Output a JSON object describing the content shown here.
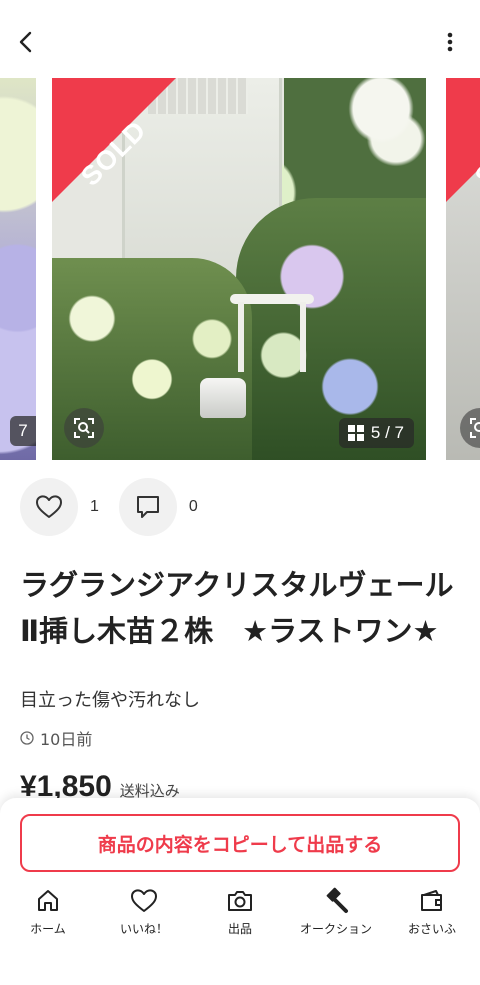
{
  "header": {
    "back_icon": "chevron-left-icon",
    "more_icon": "vertical-dots-icon"
  },
  "carousel": {
    "sold_label": "SOLD",
    "prev_counter": "7",
    "counter": "5 / 7",
    "counter_icon": "grid-icon",
    "lens_icon": "image-search-icon"
  },
  "actions": {
    "like_icon": "heart-icon",
    "like_count": "1",
    "comment_icon": "comment-icon",
    "comment_count": "0"
  },
  "product": {
    "title": "ラグランジアクリスタルヴェールⅡ挿し木苗２株　★ラストワン★",
    "condition": "目立った傷や汚れなし",
    "posted": "10日前",
    "price": "¥1,850",
    "price_note": "送料込み"
  },
  "cta": {
    "copy_listing": "商品の内容をコピーして出品する"
  },
  "nav": {
    "items": [
      {
        "label": "ホーム",
        "icon": "home-icon"
      },
      {
        "label": "いいね！",
        "icon": "heart-icon"
      },
      {
        "label": "出品",
        "icon": "camera-icon"
      },
      {
        "label": "オークション",
        "icon": "gavel-icon"
      },
      {
        "label": "おさいふ",
        "icon": "wallet-icon"
      }
    ]
  },
  "colors": {
    "accent": "#ef3b4b",
    "text": "#222222",
    "muted": "#555555"
  }
}
